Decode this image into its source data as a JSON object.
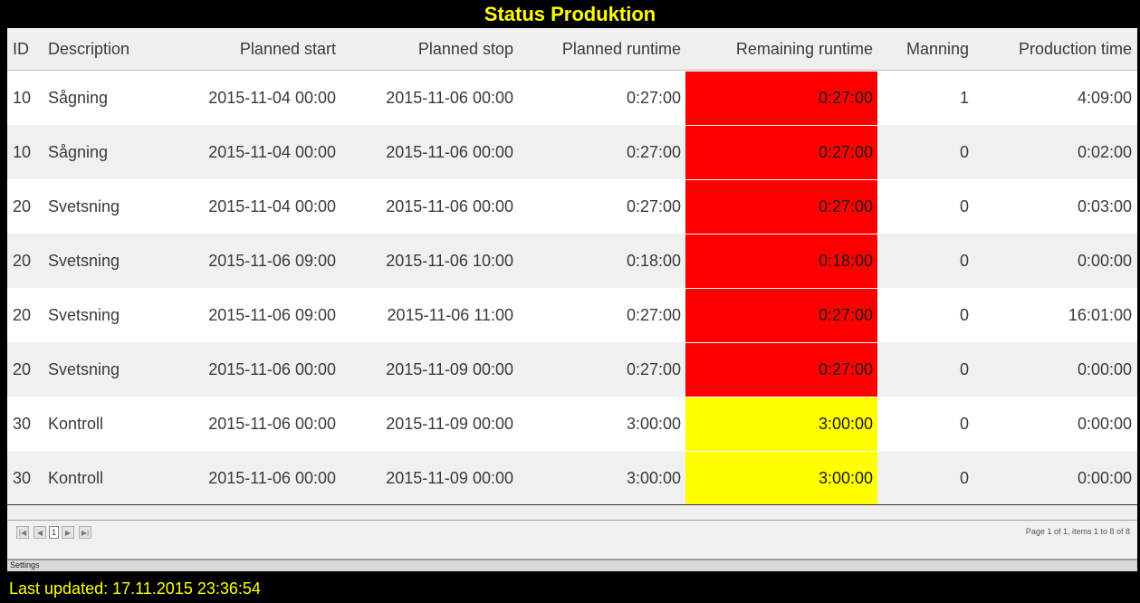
{
  "title": "Status Produktion",
  "columns": {
    "id": "ID",
    "description": "Description",
    "planned_start": "Planned start",
    "planned_stop": "Planned stop",
    "planned_runtime": "Planned runtime",
    "remaining_runtime": "Remaining runtime",
    "manning": "Manning",
    "production_time": "Production time"
  },
  "rows": [
    {
      "id": "10",
      "description": "Sågning",
      "planned_start": "2015-11-04 00:00",
      "planned_stop": "2015-11-06 00:00",
      "planned_runtime": "0:27:00",
      "remaining_runtime": "0:27:00",
      "remaining_status": "red",
      "manning": "1",
      "production_time": "4:09:00"
    },
    {
      "id": "10",
      "description": "Sågning",
      "planned_start": "2015-11-04 00:00",
      "planned_stop": "2015-11-06 00:00",
      "planned_runtime": "0:27:00",
      "remaining_runtime": "0:27:00",
      "remaining_status": "red",
      "manning": "0",
      "production_time": "0:02:00"
    },
    {
      "id": "20",
      "description": "Svetsning",
      "planned_start": "2015-11-04 00:00",
      "planned_stop": "2015-11-06 00:00",
      "planned_runtime": "0:27:00",
      "remaining_runtime": "0:27:00",
      "remaining_status": "red",
      "manning": "0",
      "production_time": "0:03:00"
    },
    {
      "id": "20",
      "description": "Svetsning",
      "planned_start": "2015-11-06 09:00",
      "planned_stop": "2015-11-06 10:00",
      "planned_runtime": "0:18:00",
      "remaining_runtime": "0:18:00",
      "remaining_status": "red",
      "manning": "0",
      "production_time": "0:00:00"
    },
    {
      "id": "20",
      "description": "Svetsning",
      "planned_start": "2015-11-06 09:00",
      "planned_stop": "2015-11-06 11:00",
      "planned_runtime": "0:27:00",
      "remaining_runtime": "0:27:00",
      "remaining_status": "red",
      "manning": "0",
      "production_time": "16:01:00"
    },
    {
      "id": "20",
      "description": "Svetsning",
      "planned_start": "2015-11-06 00:00",
      "planned_stop": "2015-11-09 00:00",
      "planned_runtime": "0:27:00",
      "remaining_runtime": "0:27:00",
      "remaining_status": "red",
      "manning": "0",
      "production_time": "0:00:00"
    },
    {
      "id": "30",
      "description": "Kontroll",
      "planned_start": "2015-11-06 00:00",
      "planned_stop": "2015-11-09 00:00",
      "planned_runtime": "3:00:00",
      "remaining_runtime": "3:00:00",
      "remaining_status": "yellow",
      "manning": "0",
      "production_time": "0:00:00"
    },
    {
      "id": "30",
      "description": "Kontroll",
      "planned_start": "2015-11-06 00:00",
      "planned_stop": "2015-11-09 00:00",
      "planned_runtime": "3:00:00",
      "remaining_runtime": "3:00:00",
      "remaining_status": "yellow",
      "manning": "0",
      "production_time": "0:00:00"
    }
  ],
  "colors": {
    "red": "#ff0000",
    "yellow": "#ffff00",
    "title": "#ffff00"
  },
  "pager": {
    "current_page": "1",
    "info": "Page 1 of 1, items 1 to 8 of 8",
    "first_icon": "first-page-icon",
    "prev_icon": "prev-page-icon",
    "next_icon": "next-page-icon",
    "last_icon": "last-page-icon"
  },
  "settings_label": "Settings",
  "footer": "Last updated: 17.11.2015 23:36:54"
}
